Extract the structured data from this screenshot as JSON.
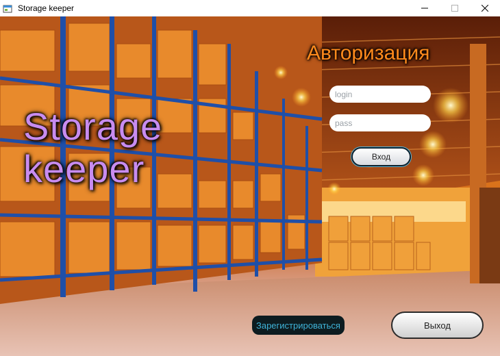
{
  "window": {
    "title": "Storage keeper",
    "app_icon": "app-window-icon",
    "controls": [
      "minimize-icon",
      "maximize-icon",
      "close-icon"
    ]
  },
  "brand": {
    "line1": "Storage",
    "line2": "keeper"
  },
  "auth": {
    "title": "Авторизация",
    "login_placeholder": "login",
    "login_value": "",
    "pass_placeholder": "pass",
    "pass_value": "",
    "enter_label": "Вход"
  },
  "footer": {
    "register_label": "Зарегистрироваться",
    "exit_label": "Выход"
  },
  "colors": {
    "brand_text": "#c88cf0",
    "auth_title": "#ff8a1c",
    "register_text": "#3fb3d8"
  }
}
